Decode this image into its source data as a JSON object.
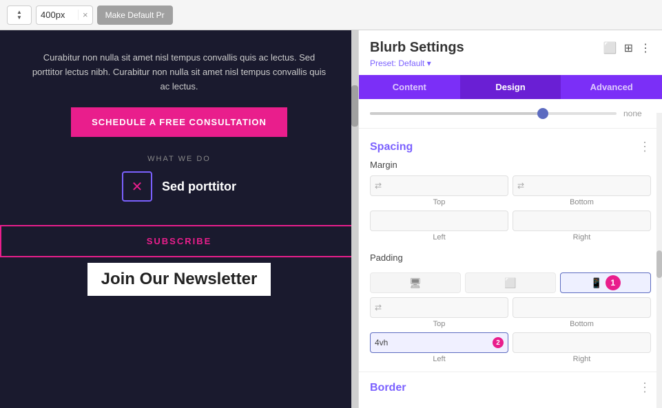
{
  "toolbar": {
    "width_value": "400px",
    "clear_icon": "×",
    "make_default_label": "Make Default Pr",
    "stepper_up": "▲",
    "stepper_down": "▼"
  },
  "preview": {
    "body_text": "Curabitur non nulla sit amet nisl tempus convallis quis ac lectus. Sed porttitor lectus nibh. Curabitur non nulla sit amet nisl tempus convallis quis ac lectus.",
    "cta_label": "SCHEDULE A FREE CONSULTATION",
    "what_we_do": "WHAT WE DO",
    "blurb_title": "Sed porttitor",
    "blurb_icon": "✕",
    "subscribe_label": "SUBSCRIBE",
    "newsletter_title": "Join Our Newsletter"
  },
  "panel": {
    "title": "Blurb Settings",
    "preset_label": "Preset: Default ▾",
    "header_icons": [
      "⬜",
      "⬛",
      "⋮"
    ],
    "tabs": [
      {
        "id": "content",
        "label": "Content",
        "active": false
      },
      {
        "id": "design",
        "label": "Design",
        "active": true
      },
      {
        "id": "advanced",
        "label": "Advanced",
        "active": false
      }
    ],
    "slider": {
      "value_label": "none"
    },
    "spacing": {
      "section_title": "Spacing",
      "margin_label": "Margin",
      "margin_fields": [
        {
          "id": "margin-top",
          "label": "Top",
          "value": ""
        },
        {
          "id": "margin-bottom",
          "label": "Bottom",
          "value": ""
        },
        {
          "id": "margin-left",
          "label": "Left",
          "value": ""
        },
        {
          "id": "margin-right",
          "label": "Right",
          "value": ""
        }
      ],
      "padding_label": "Padding",
      "padding_value_left": "4vh",
      "padding_fields": [
        {
          "id": "padding-top",
          "label": "Top",
          "value": ""
        },
        {
          "id": "padding-bottom",
          "label": "Bottom",
          "value": ""
        },
        {
          "id": "padding-left",
          "label": "Left",
          "value": "4vh"
        },
        {
          "id": "padding-right",
          "label": "Right",
          "value": ""
        }
      ]
    },
    "border": {
      "section_title": "Border"
    }
  }
}
